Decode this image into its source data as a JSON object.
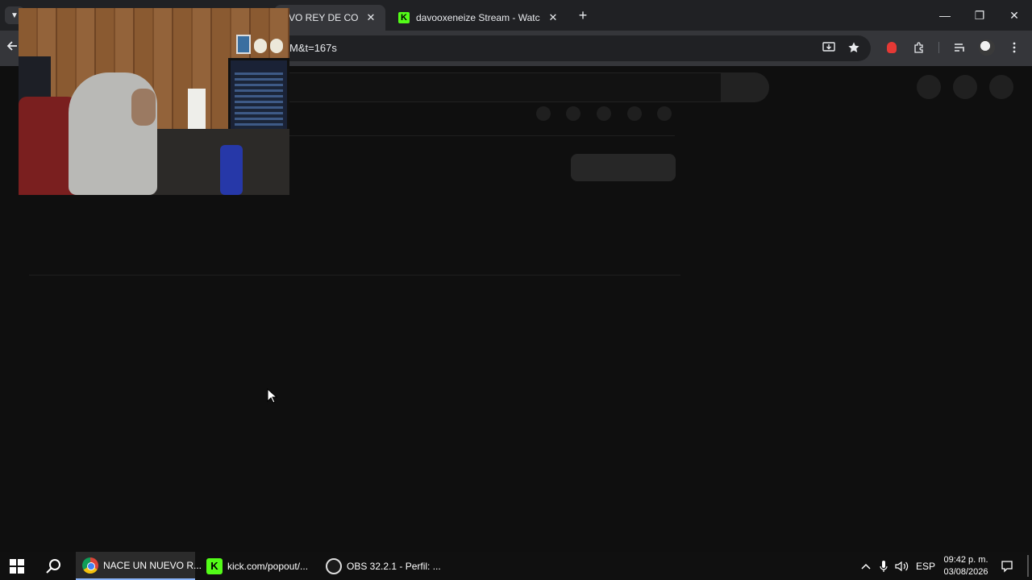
{
  "browser": {
    "tabs": [
      {
        "title": "NACE UN NUEVO REY DE COPA",
        "visible_text": "EVO REY DE COPA",
        "active": true
      },
      {
        "title": "davooxeneize Stream - Watch L",
        "active": false
      }
    ],
    "close_glyph": "✕",
    "new_tab_glyph": "+",
    "url_fragment": "M&t=167s"
  },
  "window_controls": {
    "minimize": "—",
    "restore": "❐",
    "close": "✕"
  },
  "taskbar": {
    "apps": [
      {
        "label": "NACE UN NUEVO R...",
        "icon": "chrome-icon",
        "active": true
      },
      {
        "label": "kick.com/popout/...",
        "icon": "kick-icon",
        "active": false
      },
      {
        "label": "OBS 32.2.1 - Perfil: ...",
        "icon": "obs-icon",
        "active": false
      }
    ],
    "tray": {
      "language": "ESP",
      "time": "09:42 p. m.",
      "date": "03/08/2026"
    }
  },
  "colors": {
    "kick_green": "#53fc18",
    "page_bg": "#0f0f0f",
    "toolbar_bg": "#35363a",
    "tabstrip_bg": "#202124"
  }
}
